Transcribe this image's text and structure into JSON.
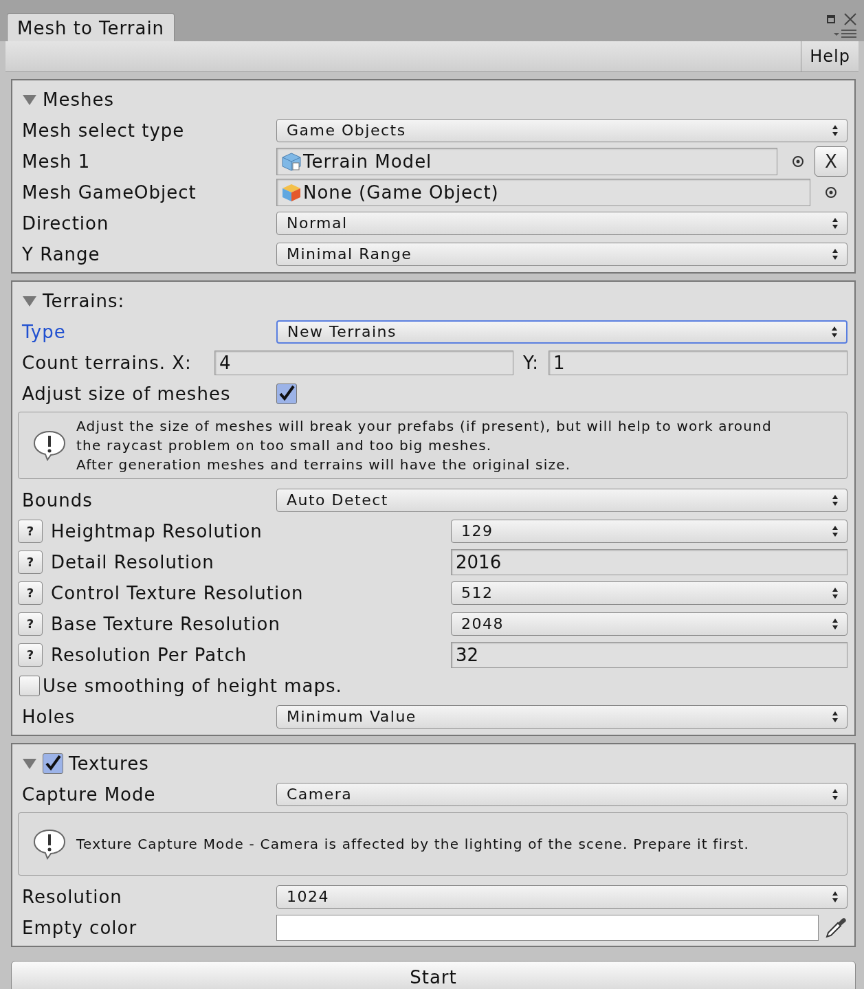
{
  "window": {
    "tab": "Mesh to Terrain",
    "toolbar_button": "Help"
  },
  "sections": [
    {
      "title": "Meshes",
      "expanded": true,
      "rows": [
        {
          "kind": "dropdown",
          "label": "Mesh select type",
          "value": "Game Objects",
          "focused": false
        },
        {
          "kind": "mesh-object",
          "label": "Mesh 1",
          "value": "Terrain Model",
          "clear": "X"
        },
        {
          "kind": "gameobject",
          "label": "Mesh GameObject",
          "value": "None (Game Object)"
        },
        {
          "kind": "dropdown",
          "label": "Direction",
          "value": "Normal",
          "focused": false
        },
        {
          "kind": "dropdown",
          "label": "Y Range",
          "value": "Minimal Range",
          "focused": false
        }
      ]
    },
    {
      "title": "Terrains:",
      "expanded": true,
      "rows": [
        {
          "kind": "dropdown",
          "label": "Type",
          "value": "New Terrains",
          "focused": true
        },
        {
          "kind": "pair",
          "label": "Count terrains. X:",
          "value": "4",
          "label2": "Y:",
          "value2": "1"
        },
        {
          "kind": "checkbox",
          "label": "Adjust size of meshes",
          "checked": true
        },
        {
          "kind": "help",
          "lines": [
            "Adjust the size of meshes will break your prefabs (if present), but will help to work around",
            "the raycast problem on too small and too big meshes.",
            "After generation meshes and terrains will have the original size."
          ]
        },
        {
          "kind": "dropdown",
          "label": "Bounds",
          "value": "Auto Detect",
          "focused": false
        },
        {
          "kind": "setting-dropdown",
          "help": "?",
          "label": "Heightmap Resolution",
          "value": "129"
        },
        {
          "kind": "setting-field",
          "help": "?",
          "label": "Detail Resolution",
          "value": "2016"
        },
        {
          "kind": "setting-dropdown",
          "help": "?",
          "label": "Control Texture Resolution",
          "value": "512"
        },
        {
          "kind": "setting-dropdown",
          "help": "?",
          "label": "Base Texture Resolution",
          "value": "2048"
        },
        {
          "kind": "setting-field",
          "help": "?",
          "label": "Resolution Per Patch",
          "value": "32"
        },
        {
          "kind": "toggle",
          "label": "Use smoothing of height maps.",
          "checked": false
        },
        {
          "kind": "dropdown",
          "label": "Holes",
          "value": "Minimum Value",
          "focused": false
        }
      ]
    },
    {
      "title": "Textures",
      "expanded": true,
      "checked": true,
      "rows": [
        {
          "kind": "dropdown",
          "label": "Capture Mode",
          "value": "Camera",
          "focused": false
        },
        {
          "kind": "help",
          "lines": [
            "Texture Capture Mode - Camera is affected by the lighting of the scene. Prepare it first."
          ]
        },
        {
          "kind": "dropdown",
          "label": "Resolution",
          "value": "1024",
          "focused": false
        },
        {
          "kind": "color",
          "label": "Empty color"
        }
      ]
    }
  ],
  "start_button": "Start"
}
